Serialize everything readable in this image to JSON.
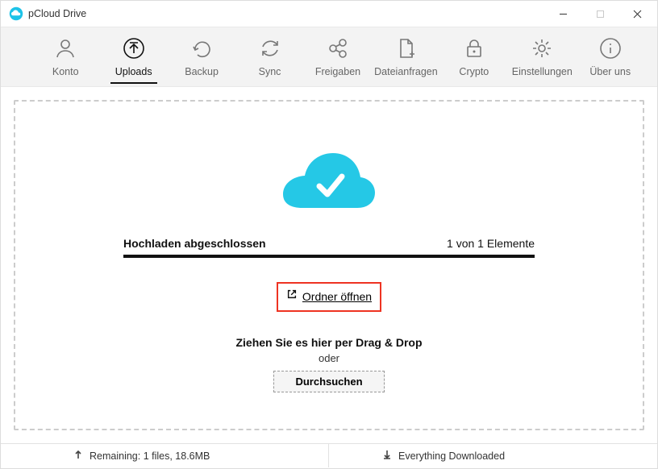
{
  "window": {
    "title": "pCloud Drive"
  },
  "toolbar": {
    "items": [
      {
        "label": "Konto"
      },
      {
        "label": "Uploads"
      },
      {
        "label": "Backup"
      },
      {
        "label": "Sync"
      },
      {
        "label": "Freigaben"
      },
      {
        "label": "Dateianfragen"
      },
      {
        "label": "Crypto"
      },
      {
        "label": "Einstellungen"
      },
      {
        "label": "Über uns"
      }
    ]
  },
  "upload": {
    "status": "Hochladen abgeschlossen",
    "count": "1 von 1 Elemente",
    "open_folder": "Ordner öffnen",
    "dnd": "Ziehen Sie es hier per Drag & Drop",
    "or": "oder",
    "browse": "Durchsuchen"
  },
  "status": {
    "remaining": "Remaining: 1 files, 18.6MB",
    "downloaded": "Everything Downloaded"
  }
}
